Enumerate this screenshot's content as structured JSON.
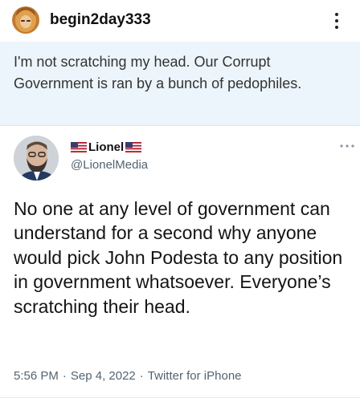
{
  "post": {
    "username": "begin2day333",
    "caption": "I'm not scratching my head. Our Corrupt Government is ran by a bunch of pedophiles.",
    "more_icon": "more-vertical-icon"
  },
  "tweet": {
    "author_name": "Lionel",
    "author_handle": "@LionelMedia",
    "flag_icon": "us-flag-icon",
    "more_icon": "more-horizontal-icon",
    "body": "No one at any level of government can understand for a second why anyone would pick John Podesta to any position in government whatsoever. Everyone’s scratching their head.",
    "time": "5:56 PM",
    "separator": "·",
    "date": "Sep 4, 2022",
    "source": "Twitter for iPhone"
  },
  "colors": {
    "caption_background": "#ecf5fb",
    "secondary_text": "#536471"
  }
}
